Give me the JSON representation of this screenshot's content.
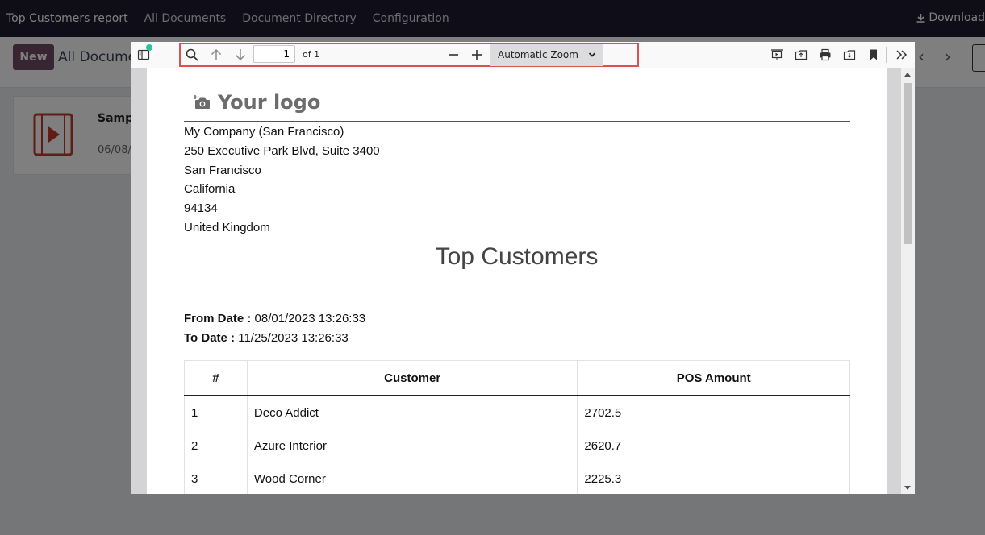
{
  "app": {
    "title": "Top Customers report",
    "nav": [
      "All Documents",
      "Document Directory",
      "Configuration"
    ],
    "download_label": "Download"
  },
  "control_panel": {
    "new_label": "New",
    "breadcrumb": "All Documents"
  },
  "card": {
    "name": "Sample",
    "date": "06/08/"
  },
  "viewer": {
    "page_number": "1",
    "page_count": "of 1",
    "zoom": "Automatic Zoom",
    "highlight_color": "#d9534f",
    "notification_color": "#2ac3a2"
  },
  "report": {
    "logo_text": "Your logo",
    "company_lines": [
      "My Company (San Francisco)",
      "250 Executive Park Blvd, Suite 3400",
      "San Francisco",
      "California",
      "94134",
      "United Kingdom"
    ],
    "title": "Top Customers",
    "from_label": "From Date :",
    "from_value": "08/01/2023 13:26:33",
    "to_label": "To Date :",
    "to_value": "11/25/2023 13:26:33",
    "table": {
      "headers": [
        "#",
        "Customer",
        "POS Amount"
      ],
      "rows": [
        [
          "1",
          "Deco Addict",
          "2702.5"
        ],
        [
          "2",
          "Azure Interior",
          "2620.7"
        ],
        [
          "3",
          "Wood Corner",
          "2225.3"
        ],
        [
          "",
          "",
          ""
        ]
      ]
    }
  }
}
